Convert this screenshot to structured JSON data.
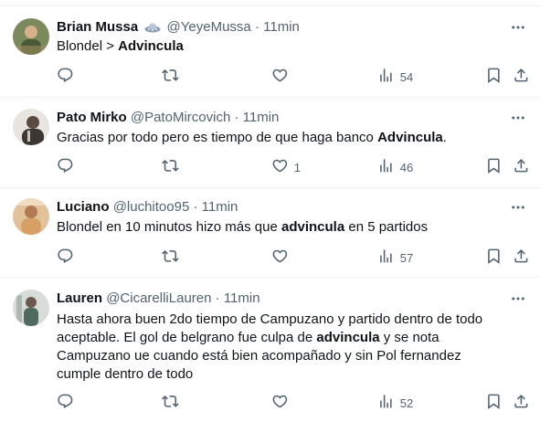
{
  "tweets": [
    {
      "name": "Brian Mussa",
      "handle": "@YeyeMussa",
      "dot": "·",
      "time": "11min",
      "text_before": "Blondel > ",
      "bold": "Advincula",
      "text_after": "",
      "likes": "",
      "views": "54",
      "avatar_color": "#7a8a5c",
      "has_badge": true
    },
    {
      "name": "Pato Mirko",
      "handle": "@PatoMircovich",
      "dot": "·",
      "time": "11min",
      "text_before": "Gracias por todo pero es tiempo de que haga banco ",
      "bold": "Advincula",
      "text_after": ".",
      "likes": "1",
      "views": "46",
      "avatar_color": "#6b6560",
      "has_badge": false
    },
    {
      "name": "Luciano",
      "handle": "@luchitoo95",
      "dot": "·",
      "time": "11min",
      "text_before": "Blondel en 10 minutos hizo más que ",
      "bold": "advincula",
      "text_after": " en 5 partidos",
      "likes": "",
      "views": "57",
      "avatar_color": "#c9a37a",
      "has_badge": false
    },
    {
      "name": "Lauren",
      "handle": "@CicarelliLauren",
      "dot": "·",
      "time": "11min",
      "text_before": "Hasta ahora buen 2do tiempo de Campuzano y partido dentro de todo aceptable. El gol de belgrano fue culpa de ",
      "bold": "advincula",
      "text_after": " y se nota Campuzano ue cuando está bien acompañado y sin Pol fernandez cumple dentro de todo",
      "likes": "",
      "views": "52",
      "avatar_color": "#9aa6a0",
      "has_badge": false
    }
  ],
  "icons": {
    "reply": "reply-icon",
    "retweet": "retweet-icon",
    "like": "heart-icon",
    "views": "views-icon",
    "bookmark": "bookmark-icon",
    "share": "share-icon",
    "more": "more-icon",
    "badge": "ufo-badge-icon"
  },
  "colors": {
    "text": "#0f1419",
    "muted": "#536471",
    "separator": "#eff3f4"
  }
}
